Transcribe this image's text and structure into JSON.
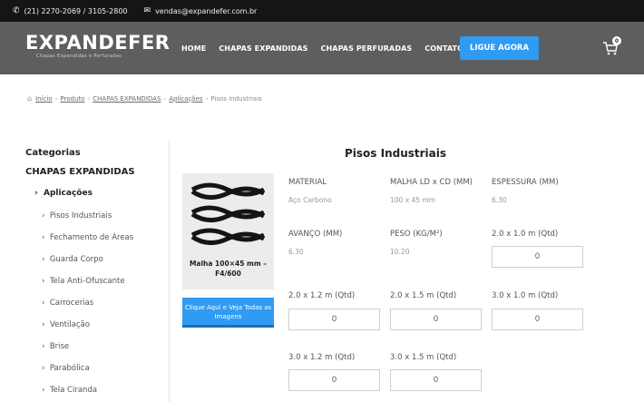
{
  "topbar": {
    "phone": "(21) 2270-2069 / 3105-2800",
    "email": "vendas@expandefer.com.br",
    "phone_icon": "phone-icon",
    "email_icon": "mail-icon"
  },
  "header": {
    "logo_text": "EXPANDEFER",
    "logo_tagline": "Chapas Expandidas e Perfuradas",
    "menu": [
      "HOME",
      "CHAPAS EXPANDIDAS",
      "CHAPAS PERFURADAS",
      "CONTATO"
    ],
    "cta": "LIGUE AGORA",
    "cart_count": "0",
    "cart_icon": "cart-icon",
    "cta_color": "#2f9bf2",
    "nav_color": "#5e5e5e"
  },
  "breadcrumb": {
    "home_icon": "home-icon",
    "items": [
      "Início",
      "Produto",
      "CHAPAS EXPANDIDAS",
      "Aplicações"
    ],
    "current": "Pisos Industriais"
  },
  "sidebar": {
    "heading": "Categorias",
    "category": "CHAPAS EXPANDIDAS",
    "subcategory": "Aplicações",
    "items": [
      "Pisos Industriais",
      "Fechamento de Áreas",
      "Guarda Corpo",
      "Tela Anti-Ofuscante",
      "Carrocerias",
      "Ventilação",
      "Brise",
      "Parabólica",
      "Tela Ciranda"
    ]
  },
  "product": {
    "title": "Pisos Industriais",
    "caption": "Malha 100×45 mm – F4/600",
    "gallery_button": "Clique Aqui e Veja Todas as Imagens",
    "specs": [
      {
        "label": "MATERIAL",
        "value": "Aço Carbono"
      },
      {
        "label": "MALHA LD x CD (MM)",
        "value": "100 x 45 mm"
      },
      {
        "label": "ESPESSURA (MM)",
        "value": "6.30"
      },
      {
        "label": "AVANÇO (MM)",
        "value": "6.30"
      },
      {
        "label": "PESO (KG/M²)",
        "value": "10.20"
      }
    ],
    "quantities": [
      {
        "label": "2.0 x 1.0 m (Qtd)",
        "value": "0"
      },
      {
        "label": "2.0 x 1.2 m (Qtd)",
        "value": "0"
      },
      {
        "label": "2.0 x 1.5 m (Qtd)",
        "value": "0"
      },
      {
        "label": "3.0 x 1.0 m (Qtd)",
        "value": "0"
      },
      {
        "label": "3.0 x 1.2 m (Qtd)",
        "value": "0"
      },
      {
        "label": "3.0 x 1.5 m (Qtd)",
        "value": "0"
      }
    ]
  }
}
